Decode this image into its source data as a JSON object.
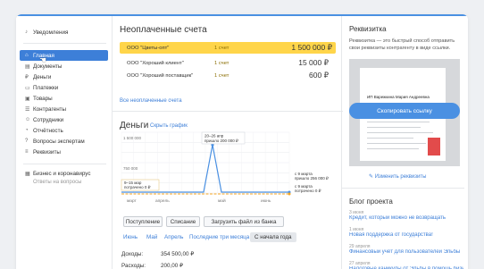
{
  "sidebar": {
    "notifications": "Уведомления",
    "items": [
      {
        "label": "Главная",
        "icon": "home-icon",
        "glyph": "⌂"
      },
      {
        "label": "Документы",
        "icon": "document-icon",
        "glyph": "▤"
      },
      {
        "label": "Деньги",
        "icon": "money-icon",
        "glyph": "₽"
      },
      {
        "label": "Платежки",
        "icon": "payment-icon",
        "glyph": "▭"
      },
      {
        "label": "Товары",
        "icon": "box-icon",
        "glyph": "▣"
      },
      {
        "label": "Контрагенты",
        "icon": "contacts-icon",
        "glyph": "☰"
      },
      {
        "label": "Сотрудники",
        "icon": "people-icon",
        "glyph": "☺"
      },
      {
        "label": "Отчётность",
        "icon": "report-icon",
        "glyph": "◔"
      },
      {
        "label": "Вопросы экспертам",
        "icon": "question-icon",
        "glyph": "?"
      },
      {
        "label": "Реквизиты",
        "icon": "requisites-icon",
        "glyph": "≡"
      }
    ],
    "business_item": "Бизнес и коронавирус",
    "business_sub": "Ответы на вопросы"
  },
  "unpaid": {
    "title": "Неоплаченные счета",
    "rows": [
      {
        "name": "ООО \"Цветы-опт\"",
        "count": "1 счет",
        "sum": "1 500 000 ₽",
        "highlight": true
      },
      {
        "name": "ООО \"Хороший клиент\"",
        "count": "1 счет",
        "sum": "15 000 ₽",
        "highlight": false
      },
      {
        "name": "ООО \"Хороший поставщик\"",
        "count": "1 счет",
        "sum": "600 ₽",
        "highlight": false
      }
    ],
    "all_link": "Все неоплаченные счета"
  },
  "money": {
    "title": "Деньги",
    "hide_chart": "Скрыть график",
    "buttons": {
      "income": "Поступление",
      "expense": "Списание",
      "upload": "Загрузить файл из банка"
    },
    "periods": [
      "Июнь",
      "Май",
      "Апрель",
      "Последние три месяца",
      "С начала года"
    ],
    "selected_period": "С начала года",
    "income_label": "Доходы:",
    "income_value": "354 500,00 ₽",
    "expense_label": "Расходы:",
    "expense_value": "200,00 ₽"
  },
  "chart_data": {
    "type": "line",
    "x": [
      "март",
      "апрель",
      "май",
      "июнь"
    ],
    "ytick_labels": [
      "1 500 000",
      "750 000"
    ],
    "series": [
      {
        "color": "#4a90e2",
        "peak_label": "20–26 апр",
        "peak_sub": "пришло 200 000 ₽",
        "peak_value": 200000
      },
      {
        "color": "#f5a623"
      }
    ],
    "annotations": [
      {
        "text": "9–15 мар",
        "sub": "потрачено 0 ₽"
      },
      {
        "text": "с 9 марта",
        "sub": "пришло 256 000 ₽"
      },
      {
        "text": "с 9 марта",
        "sub": "потрачено 0 ₽"
      }
    ],
    "ylim": [
      0,
      1500000
    ],
    "grid": true
  },
  "requisites": {
    "title": "Реквизитка",
    "desc": "Реквизитка — это быстрый способ отправить свои реквизиты контрагенту в виде ссылки.",
    "card_owner": "ИП Варежкина Мария Андреевна",
    "copy_button": "Скопировать ссылку",
    "edit_link": "Изменить реквизиты"
  },
  "blog": {
    "title": "Блог проекта",
    "posts": [
      {
        "date": "3 июня",
        "title": "Кредит, который можно не возвращать"
      },
      {
        "date": "1 июня",
        "title": "Новая поддержка от государства!"
      },
      {
        "date": "29 апреля",
        "title": "Финансовый учёт для пользователей Эльбы"
      },
      {
        "date": "27 апреля",
        "title": "Налоговые каникулы от Эльбы в помощь бизнесу"
      }
    ]
  },
  "colors": {
    "accent": "#3d7fd8",
    "highlight": "#ffd54a",
    "line_blue": "#4a90e2",
    "line_orange": "#f5a623"
  }
}
